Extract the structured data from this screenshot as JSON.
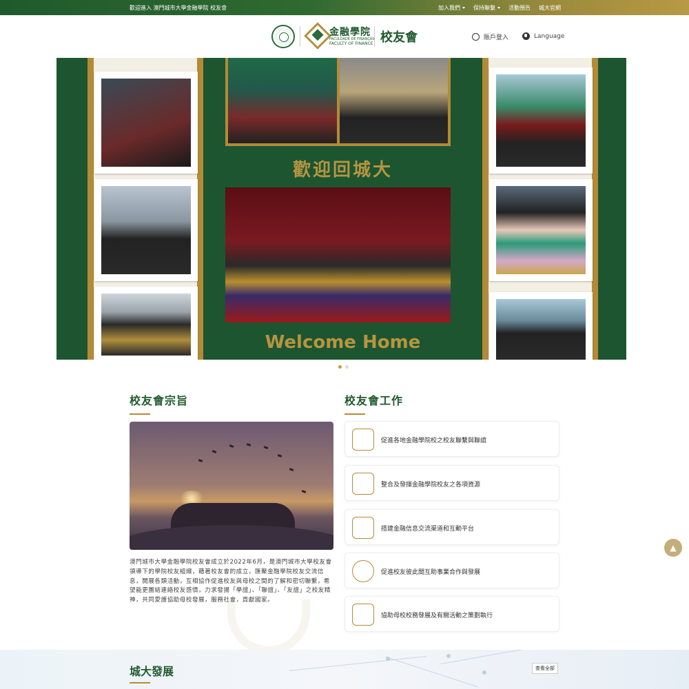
{
  "topbar": {
    "welcome": "歡迎進入 澳門城市大學金融學院 校友會",
    "nav": [
      {
        "label": "加入我們",
        "dropdown": true
      },
      {
        "label": "保持聯繫",
        "dropdown": true
      },
      {
        "label": "活動預告",
        "dropdown": false
      },
      {
        "label": "城大官網",
        "dropdown": false
      }
    ]
  },
  "header": {
    "logo_cn": "金融學院",
    "logo_pt": "FACULDADE DE FINANÇAS",
    "logo_en": "FACULTY OF FINANCE",
    "site_name": "校友會",
    "login": "賬戶登入",
    "language": "Language"
  },
  "banner": {
    "welcome_cn": "歡迎回城大",
    "welcome_en": "Welcome Home",
    "slides": 2,
    "active_slide": 1
  },
  "purpose": {
    "title": "校友會宗旨",
    "text": "澳門城市大學金融學院校友會成立於2022年6月，是澳門城市大學校友會領導下的學院校友組織，藉著校友會的成立，匯聚金融學院校友交流信息，開展各類活動，互相協作促進校友與母校之間的了解和密切聯繫，希望能更團結連絡校友感情，力求發揚「學誼」、「聯誼」、「友誼」之校友精神，共同愛護協助母校發展，服務社會，貢獻國家。"
  },
  "work": {
    "title": "校友會工作",
    "items": [
      {
        "label": "促進各地金融學院校之校友聯繫與聯誼",
        "icon": "chat-bubbles-icon"
      },
      {
        "label": "整合及發揮金融學院校友之各項資源",
        "icon": "mailbox-icon"
      },
      {
        "label": "搭建金融信息交流渠道和互動平台",
        "icon": "hands-box-icon"
      },
      {
        "label": "促進校友彼此間互助事業合作與發展",
        "icon": "clover-icon"
      },
      {
        "label": "協助母校校務發展及有關活動之策劃執行",
        "icon": "open-book-icon"
      }
    ]
  },
  "development": {
    "title": "城大發展",
    "view_all": "查看全部"
  },
  "colors": {
    "brand_green": "#1f5a2c",
    "gold": "#b38b36"
  }
}
